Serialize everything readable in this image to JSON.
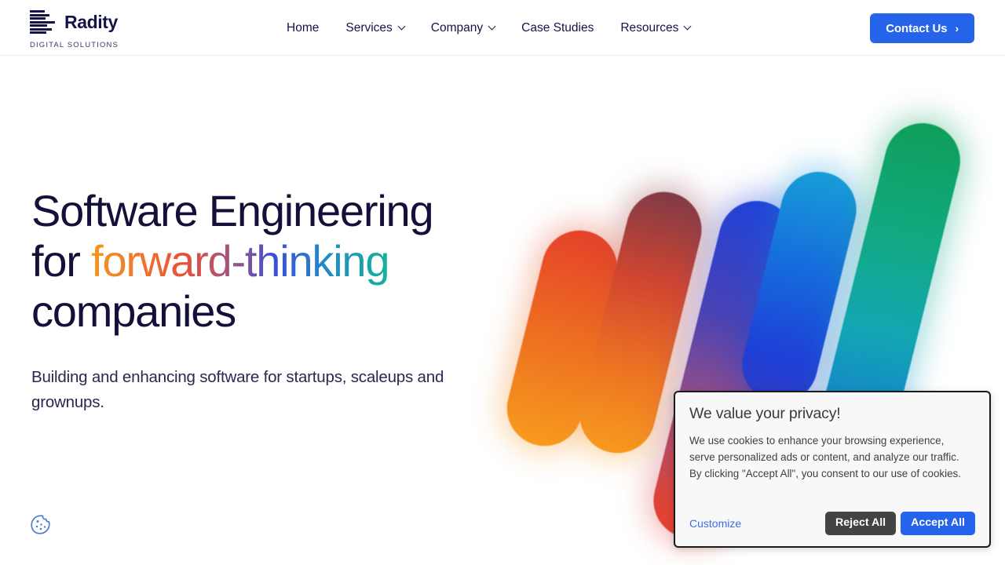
{
  "header": {
    "logo": {
      "name": "Radity",
      "tagline": "DIGITAL SOLUTIONS",
      "mark_icon": "stacked-bars-logo-icon"
    },
    "nav": [
      {
        "label": "Home",
        "has_dropdown": false
      },
      {
        "label": "Services",
        "has_dropdown": true
      },
      {
        "label": "Company",
        "has_dropdown": true
      },
      {
        "label": "Case Studies",
        "has_dropdown": false
      },
      {
        "label": "Resources",
        "has_dropdown": true
      }
    ],
    "cta": {
      "label": "Contact Us",
      "arrow": "›",
      "color": "#2563eb"
    }
  },
  "hero": {
    "title_line1": "Software Engineering",
    "title_line2_prefix": "for ",
    "title_line2_gradient": "forward-thinking",
    "title_line3": "companies",
    "subtitle": "Building and enhancing software for startups, scaleups and grownups.",
    "gradient_colors": [
      "#f7941e",
      "#e8513a",
      "#a1547e",
      "#3b4fd8",
      "#17b29a"
    ],
    "graphic": {
      "name": "radity-bars-illustration",
      "bars": [
        {
          "id": 1,
          "from": "#e4402c",
          "to": "#f79d1e"
        },
        {
          "id": 2,
          "from": "#7d3a48",
          "to": "#f79d1e"
        },
        {
          "id": 3,
          "from": "#1f42d8",
          "to": "#e8402c"
        },
        {
          "id": 4,
          "from": "#18a0d8",
          "to": "#2f3cc4"
        },
        {
          "id": 5,
          "from": "#0f9f59",
          "to": "#1a54dd"
        }
      ]
    }
  },
  "cookie_fab": {
    "icon": "cookie-icon",
    "color": "#4a7fd4"
  },
  "consent": {
    "title": "We value your privacy!",
    "body": "We use cookies to enhance your browsing experience, serve personalized ads or content, and analyze our traffic. By clicking \"Accept All\", you consent to our use of cookies.",
    "customize_label": "Customize",
    "reject_label": "Reject All",
    "accept_label": "Accept All",
    "reject_color": "#434343",
    "accept_color": "#2563eb"
  }
}
